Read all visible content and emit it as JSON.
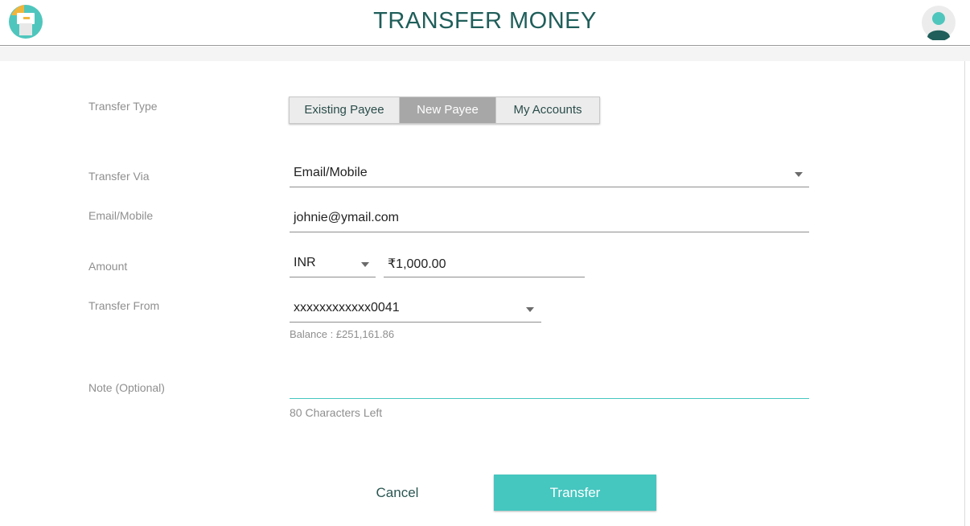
{
  "header": {
    "title": "TRANSFER MONEY",
    "logo_icon": "app-logo-icon",
    "avatar_icon": "user-avatar-icon"
  },
  "form": {
    "transfer_type": {
      "label": "Transfer Type",
      "options": [
        "Existing Payee",
        "New Payee",
        "My Accounts"
      ],
      "selected": "New Payee"
    },
    "transfer_via": {
      "label": "Transfer Via",
      "value": "Email/Mobile"
    },
    "email_mobile": {
      "label": "Email/Mobile",
      "value": "johnie@ymail.com"
    },
    "amount": {
      "label": "Amount",
      "currency": "INR",
      "value": "₹1,000.00"
    },
    "transfer_from": {
      "label": "Transfer From",
      "value": "xxxxxxxxxxxx0041",
      "balance": "Balance : £251,161.86"
    },
    "note": {
      "label": "Note (Optional)",
      "value": "",
      "chars_left": "80 Characters Left"
    }
  },
  "actions": {
    "cancel": "Cancel",
    "transfer": "Transfer"
  },
  "colors": {
    "accent": "#45c6bf",
    "title": "#1f5e5a",
    "segment_active": "#a7a7a7"
  }
}
